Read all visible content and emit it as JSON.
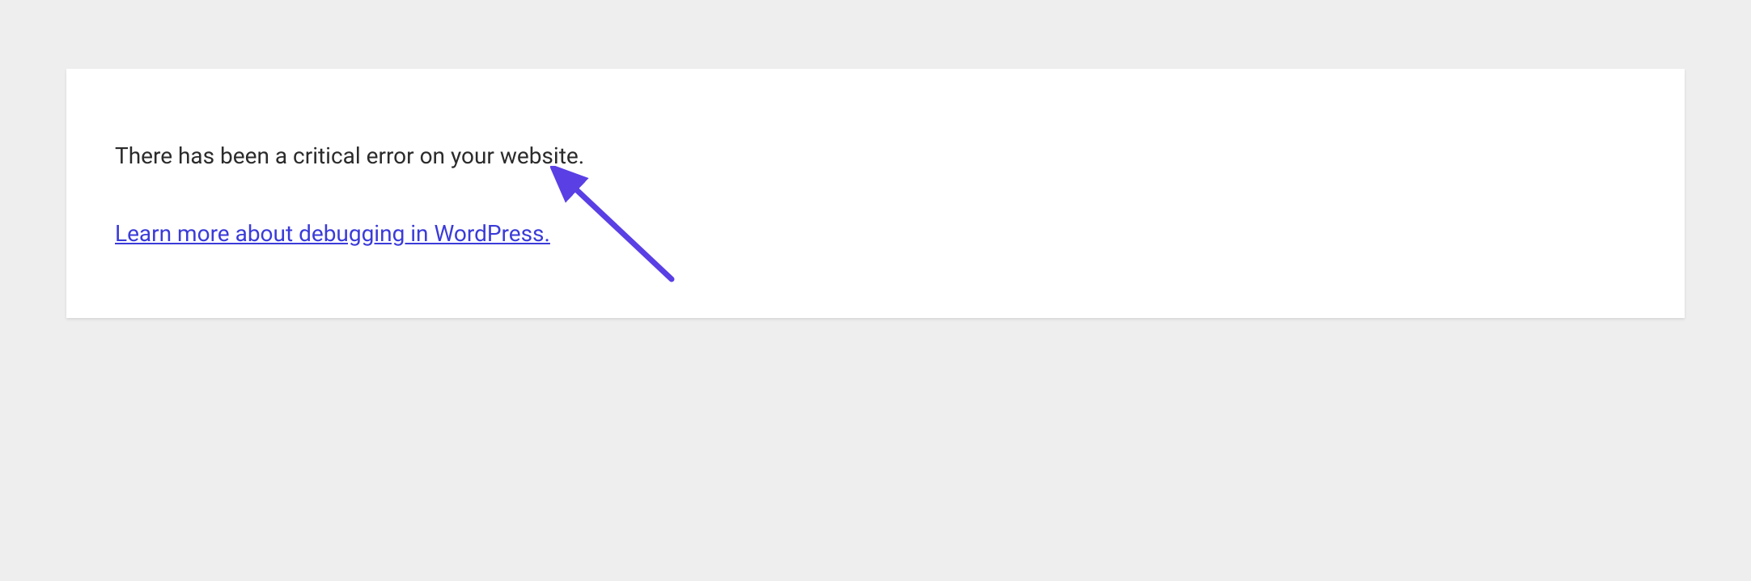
{
  "error": {
    "message": "There has been a critical error on your website.",
    "link_text": "Learn more about debugging in WordPress."
  }
}
